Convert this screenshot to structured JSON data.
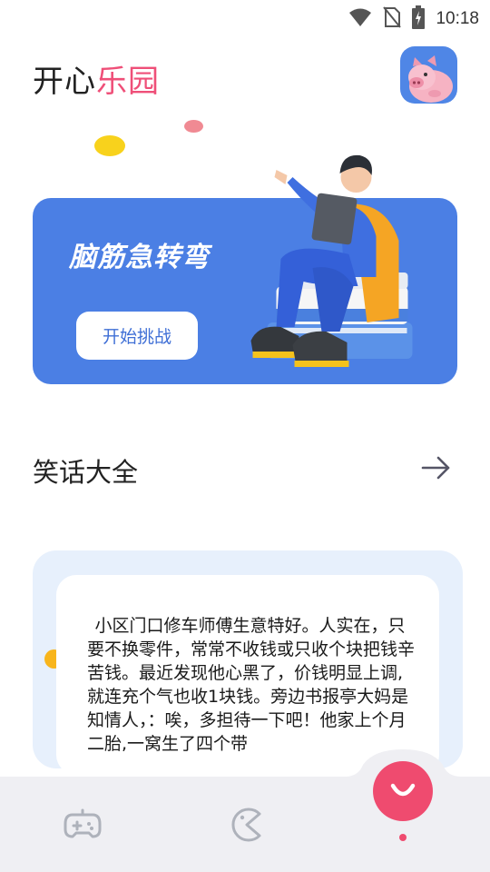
{
  "status_bar": {
    "time": "10:18",
    "icons": [
      "wifi-icon",
      "no-sim-icon",
      "battery-charging-icon"
    ]
  },
  "header": {
    "title_part1": "开心",
    "title_part2": "乐园",
    "avatar_icon": "pig-avatar-icon"
  },
  "banner": {
    "title": "脑筋急转弯",
    "button_label": "开始挑战"
  },
  "jokes_section": {
    "title": "笑话大全",
    "arrow_icon": "arrow-right-icon",
    "joke_text": "小区门口修车师傅生意特好。人实在，只要不换零件，常常不收钱或只收个块把钱辛苦钱。最近发现他心黑了，价钱明显上调,就连充个气也收1块钱。旁边书报亭大妈是知情人，：唉，多担待一下吧！他家上个月二胎,一窝生了四个带"
  },
  "bottom_nav": {
    "items": [
      "gamepad-icon",
      "pacman-icon",
      "smile-icon"
    ],
    "active_index": 2
  },
  "colors": {
    "accent_pink": "#ef4b6f",
    "banner_blue": "#4b7fe4",
    "card_bg": "#e7f0fc",
    "nav_bg": "#efeff3"
  }
}
